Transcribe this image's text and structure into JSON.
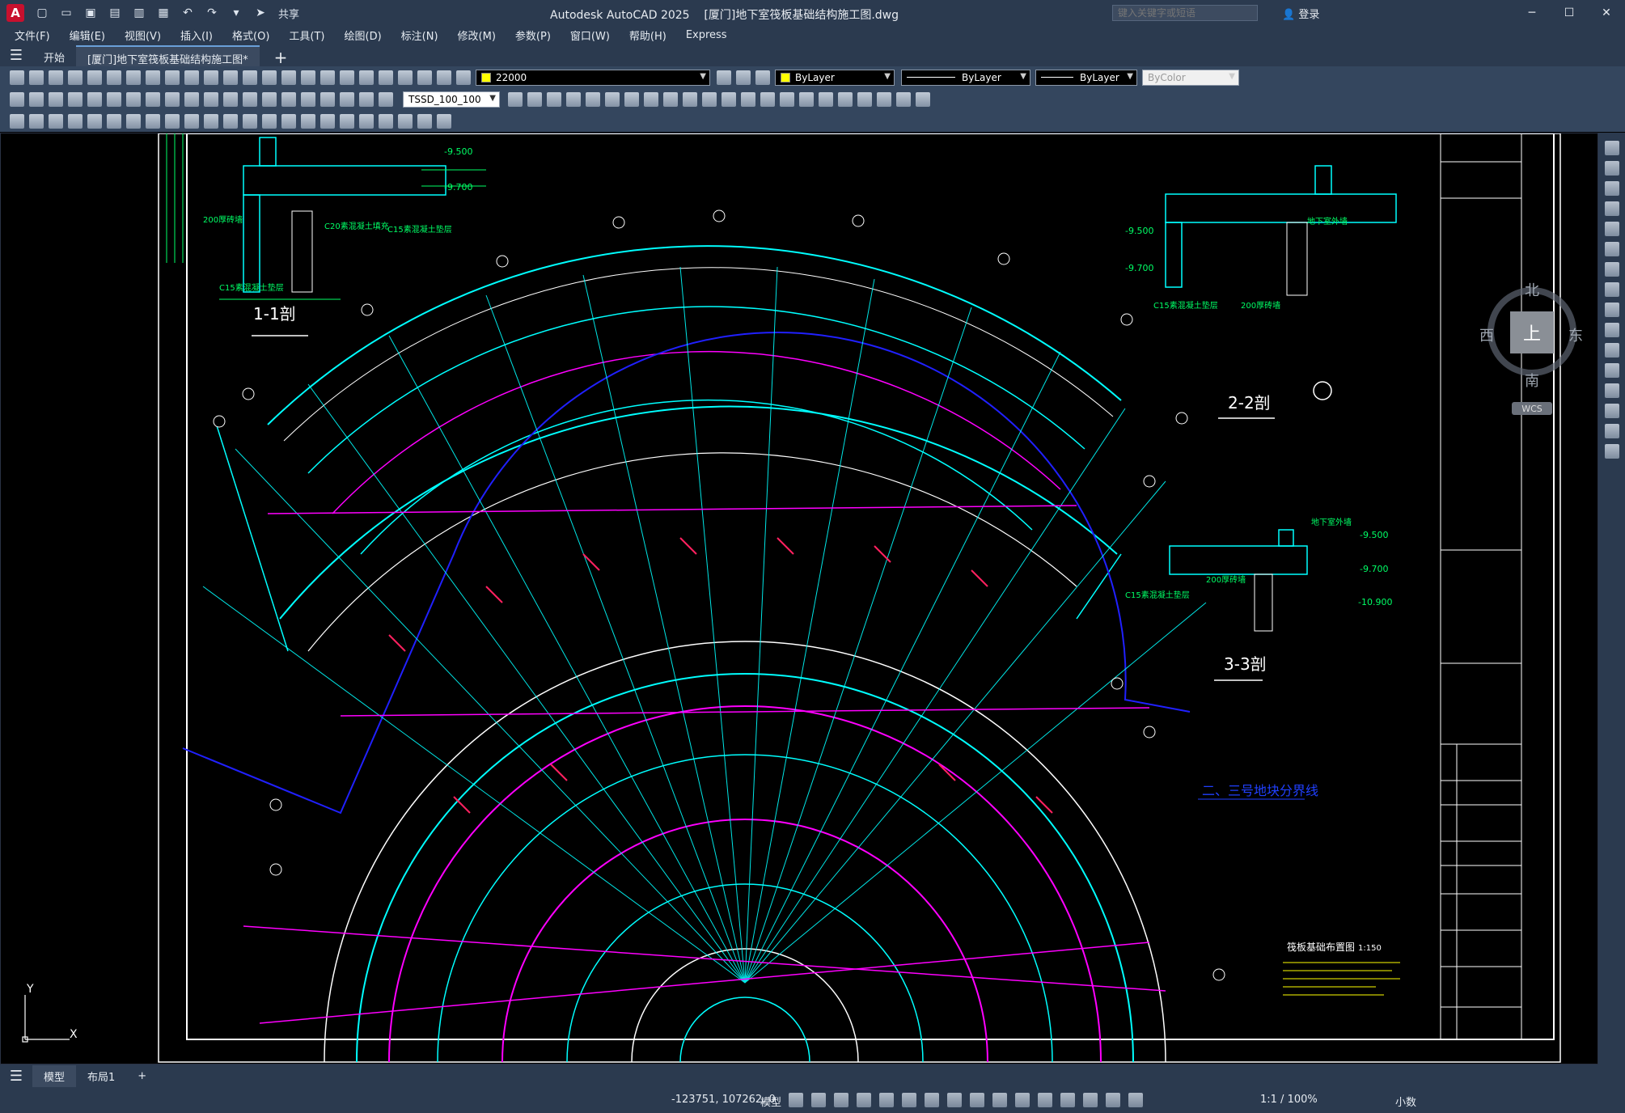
{
  "app": {
    "title": "Autodesk AutoCAD 2025",
    "document": "[厦门]地下室筏板基础结构施工图.dwg",
    "share_label": "共享",
    "search_placeholder": "键入关键字或短语",
    "login_label": "登录",
    "logo": "A"
  },
  "menu": [
    "文件(F)",
    "编辑(E)",
    "视图(V)",
    "插入(I)",
    "格式(O)",
    "工具(T)",
    "绘图(D)",
    "标注(N)",
    "修改(M)",
    "参数(P)",
    "窗口(W)",
    "帮助(H)",
    "Express"
  ],
  "tabs": [
    {
      "label": "开始",
      "active": false
    },
    {
      "label": "[厦门]地下室筏板基础结构施工图*",
      "active": true
    }
  ],
  "toolbar": {
    "layer": "22000",
    "color": "ByLayer",
    "linetype": "ByLayer",
    "lineweight": "ByLayer",
    "plotstyle": "ByColor",
    "dimstyle": "TSSD_100_100"
  },
  "viewcube": {
    "north": "北",
    "south": "南",
    "east": "东",
    "west": "西",
    "top": "上",
    "wcs": "WCS"
  },
  "drawing": {
    "section_1": "1-1剖",
    "section_2": "2-2剖",
    "section_3": "3-3剖",
    "boundary_note": "二、三号地块分界线",
    "elev_1": "-9.500",
    "elev_2": "-9.700",
    "elev_3": "-10.900",
    "c15": "C15素混凝土垫层",
    "brick": "200厚砖墙",
    "c20": "C20素混凝土填充",
    "basement_floor": "地下室外墙",
    "plan_title": "筏板基础布置图",
    "plan_scale": "1:150"
  },
  "layouts": [
    {
      "label": "模型",
      "active": true
    },
    {
      "label": "布局1",
      "active": false
    }
  ],
  "status": {
    "coords": "-123751, 107262, 0",
    "mode": "模型",
    "scale": "1:1 / 100%",
    "units": "小数"
  }
}
